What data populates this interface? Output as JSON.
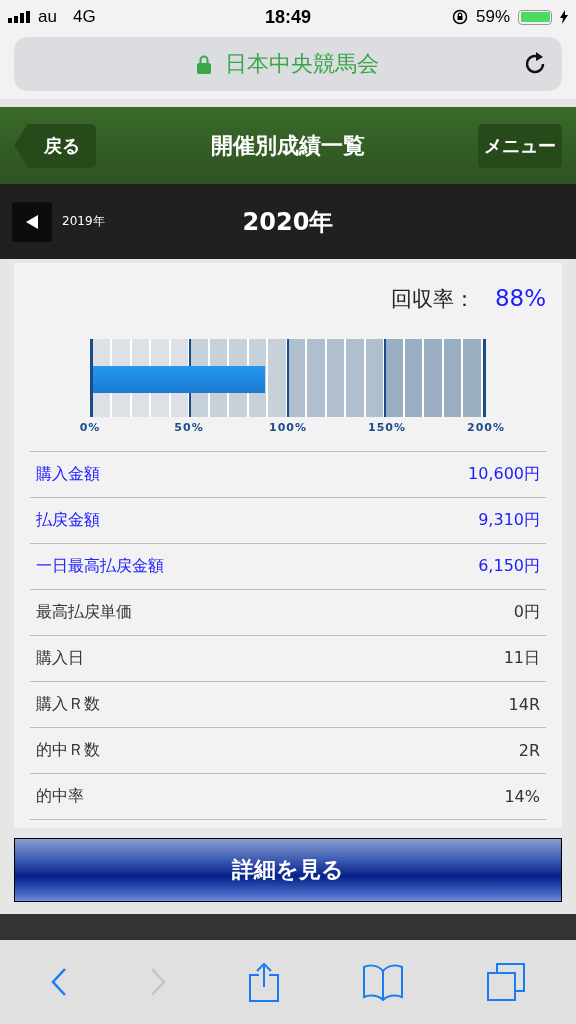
{
  "status_bar": {
    "carrier": "au",
    "network": "4G",
    "time": "18:49",
    "battery": "59%"
  },
  "address_bar": {
    "site": "日本中央競馬会"
  },
  "header": {
    "back": "戻る",
    "title": "開催別成績一覧",
    "menu": "メニュー"
  },
  "year_nav": {
    "previous": "2019年",
    "current": "2020年"
  },
  "recovery": {
    "label": "回収率：",
    "value": "88%"
  },
  "gauge": {
    "level": 0.44,
    "ticks": [
      "0%",
      "50%",
      "100%",
      "150%",
      "200%"
    ]
  },
  "rows": [
    {
      "kind": "link",
      "label": "購入金額",
      "value": "10,600円"
    },
    {
      "kind": "link",
      "label": "払戻金額",
      "value": "9,310円"
    },
    {
      "kind": "link",
      "label": "一日最高払戻金額",
      "value": "6,150円"
    },
    {
      "kind": "plain",
      "label": "最高払戻単価",
      "value": "0円"
    },
    {
      "kind": "plain",
      "label": "購入日",
      "value": "11日"
    },
    {
      "kind": "plain",
      "label": "購入Ｒ数",
      "value": "14R"
    },
    {
      "kind": "plain",
      "label": "的中Ｒ数",
      "value": "2R"
    },
    {
      "kind": "plain",
      "label": "的中率",
      "value": "14%"
    }
  ],
  "detail_button": "詳細を見る",
  "toolbar": {
    "forward_disabled": true
  }
}
